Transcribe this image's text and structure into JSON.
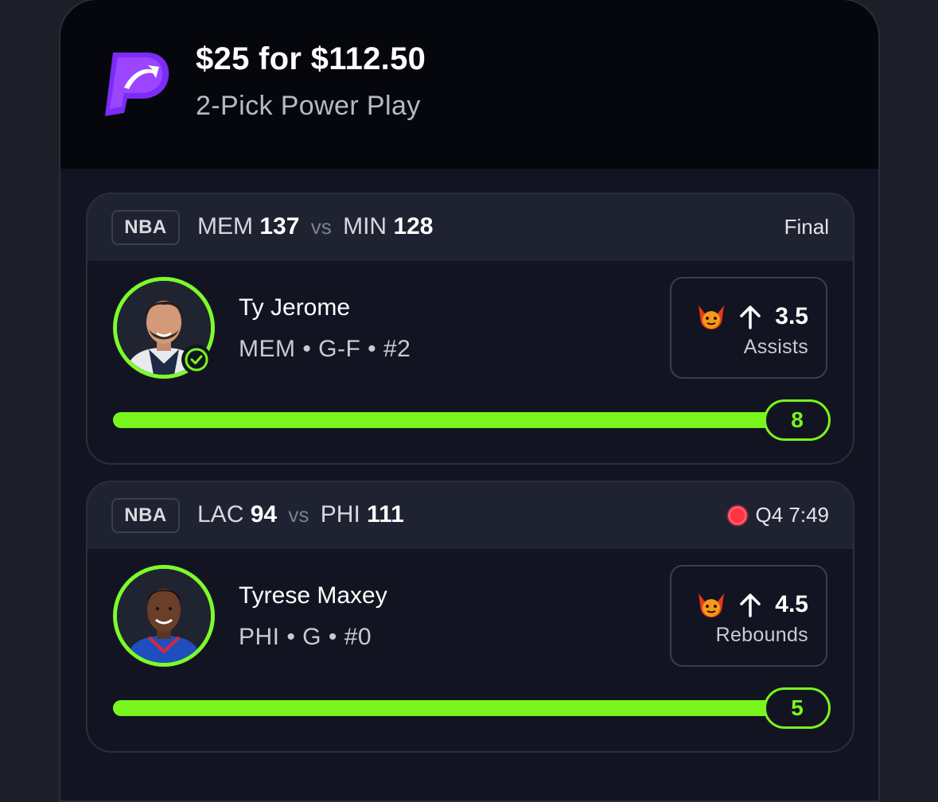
{
  "header": {
    "brand_logo": "prizepicks-logo",
    "payout": "$25 for $112.50",
    "play_type": "2-Pick Power Play"
  },
  "picks": [
    {
      "league": "NBA",
      "game": {
        "team_a": "MEM",
        "score_a": "137",
        "vs": "vs",
        "team_b": "MIN",
        "score_b": "128",
        "status": "Final",
        "live": false
      },
      "player": {
        "name": "Ty Jerome",
        "meta": "MEM • G-F • #2",
        "avatar_icon": "player-headshot",
        "checked": true
      },
      "projection": {
        "icon": "demon-icon",
        "direction_icon": "arrow-up-icon",
        "line": "3.5",
        "stat": "Assists"
      },
      "actual": "8",
      "progress_fraction": 1.0
    },
    {
      "league": "NBA",
      "game": {
        "team_a": "LAC",
        "score_a": "94",
        "vs": "vs",
        "team_b": "PHI",
        "score_b": "111",
        "status": "Q4 7:49",
        "live": true
      },
      "player": {
        "name": "Tyrese Maxey",
        "meta": "PHI • G • #0",
        "avatar_icon": "player-headshot",
        "checked": false
      },
      "projection": {
        "icon": "demon-icon",
        "direction_icon": "arrow-up-icon",
        "line": "4.5",
        "stat": "Rebounds"
      },
      "actual": "5",
      "progress_fraction": 1.0
    }
  ],
  "colors": {
    "accent_green": "#79f61e",
    "brand_purple": "#8a2cff",
    "live_red": "#ff3344",
    "card_bg": "#121521"
  }
}
